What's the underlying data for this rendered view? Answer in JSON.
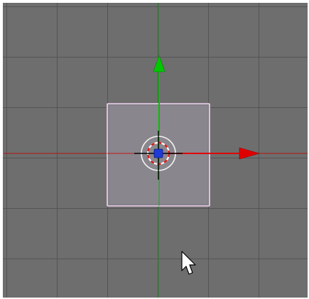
{
  "app": {
    "title": "",
    "viewport_label": ""
  },
  "colors": {
    "viewport_bg": "#6e6e6e",
    "grid_line": "#555555",
    "x_axis": "#b21414",
    "y_axis": "#1ea01e",
    "selection_outline": "#e8c9e8",
    "selected_object_fill": "#8a868d",
    "manipulator_x": "#e00000",
    "manipulator_y": "#00c000",
    "pivot": "#1a2fd0"
  },
  "icons": {
    "cursor": "mouse-pointer-icon",
    "pivot": "pivot-point-icon",
    "crosshair": "3d-cursor-icon"
  }
}
